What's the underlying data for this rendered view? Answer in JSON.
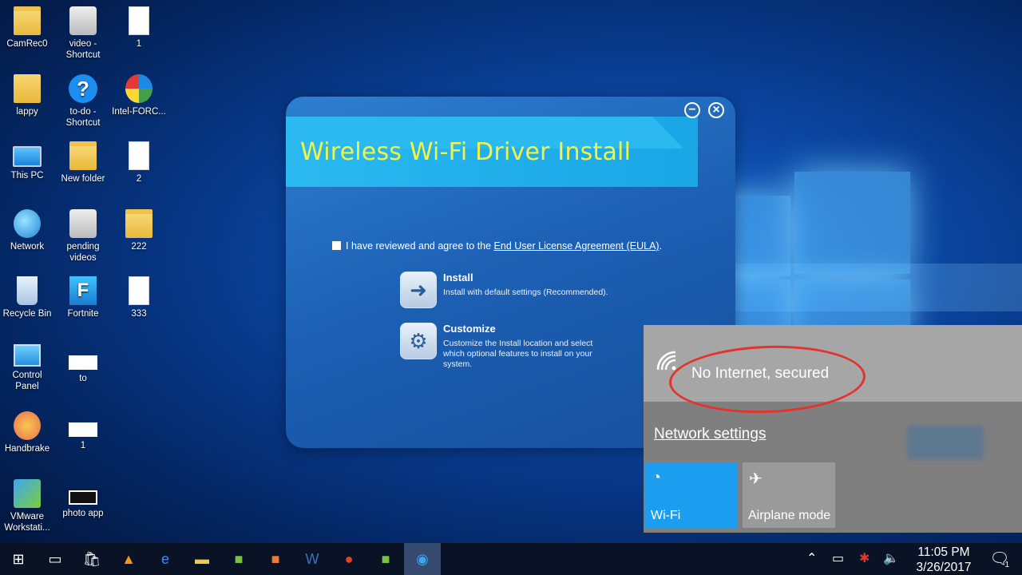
{
  "desktop_icons": [
    {
      "label": "CamRec0",
      "icon": "folder-icon"
    },
    {
      "label": "video -\nShortcut",
      "icon": "camera-shortcut-icon"
    },
    {
      "label": "1",
      "icon": "document-icon"
    },
    {
      "label": "lappy",
      "icon": "user-folder-icon"
    },
    {
      "label": "to-do -\nShortcut",
      "icon": "help-shortcut-icon"
    },
    {
      "label": "Intel-FORC...",
      "icon": "intel-icon"
    },
    {
      "label": "This PC",
      "icon": "computer-icon"
    },
    {
      "label": "New folder",
      "icon": "folder-icon"
    },
    {
      "label": "2",
      "icon": "document-icon"
    },
    {
      "label": "Network",
      "icon": "network-globe-icon"
    },
    {
      "label": "pending\nvideos",
      "icon": "media-folder-icon"
    },
    {
      "label": "222",
      "icon": "folder-icon"
    },
    {
      "label": "Recycle Bin",
      "icon": "recycle-bin-icon"
    },
    {
      "label": "Fortnite",
      "icon": "fortnite-icon"
    },
    {
      "label": "333",
      "icon": "document-icon"
    },
    {
      "label": "Control\nPanel",
      "icon": "control-panel-icon"
    },
    {
      "label": "to",
      "icon": "blank-file-icon"
    },
    {
      "label": "Handbrake",
      "icon": "handbrake-icon"
    },
    {
      "label": "1",
      "icon": "blank-file-icon"
    },
    {
      "label": "VMware\nWorkstati...",
      "icon": "vmware-icon"
    },
    {
      "label": "photo app",
      "icon": "photo-app-icon"
    }
  ],
  "installer": {
    "title": "Wireless Wi-Fi Driver Install",
    "minimize_symbol": "−",
    "close_symbol": "×",
    "eula_text": "I have reviewed and agree to the ",
    "eula_link": "End User License Agreement (EULA)",
    "eula_end": ".",
    "install_title": "Install",
    "install_desc": "Install with default settings (Recommended).",
    "customize_title": "Customize",
    "customize_desc": "Customize the Install location and select which optional features to install on your system."
  },
  "flyout": {
    "status": "No Internet, secured",
    "network_settings": "Network settings",
    "tiles": [
      {
        "label": "Wi-Fi",
        "active": true,
        "color": "#1b9ef0"
      },
      {
        "label": "Airplane mode",
        "active": false,
        "color": "#9a9a9a"
      }
    ]
  },
  "taskbar": {
    "apps": [
      "start-icon",
      "task-view-icon",
      "store-icon",
      "vlc-icon",
      "edge-icon",
      "file-explorer-icon",
      "camtasia-icon",
      "office-icon",
      "word-icon",
      "chrome-icon",
      "camtasia-recorder-icon",
      "wifi-installer-icon"
    ],
    "time": "11:05 PM",
    "date": "3/26/2017",
    "notification_count": "1"
  },
  "colors": {
    "installer_title": "#f2f545",
    "wifi_tile": "#1b9ef0",
    "red_annotation": "#e2332f"
  }
}
